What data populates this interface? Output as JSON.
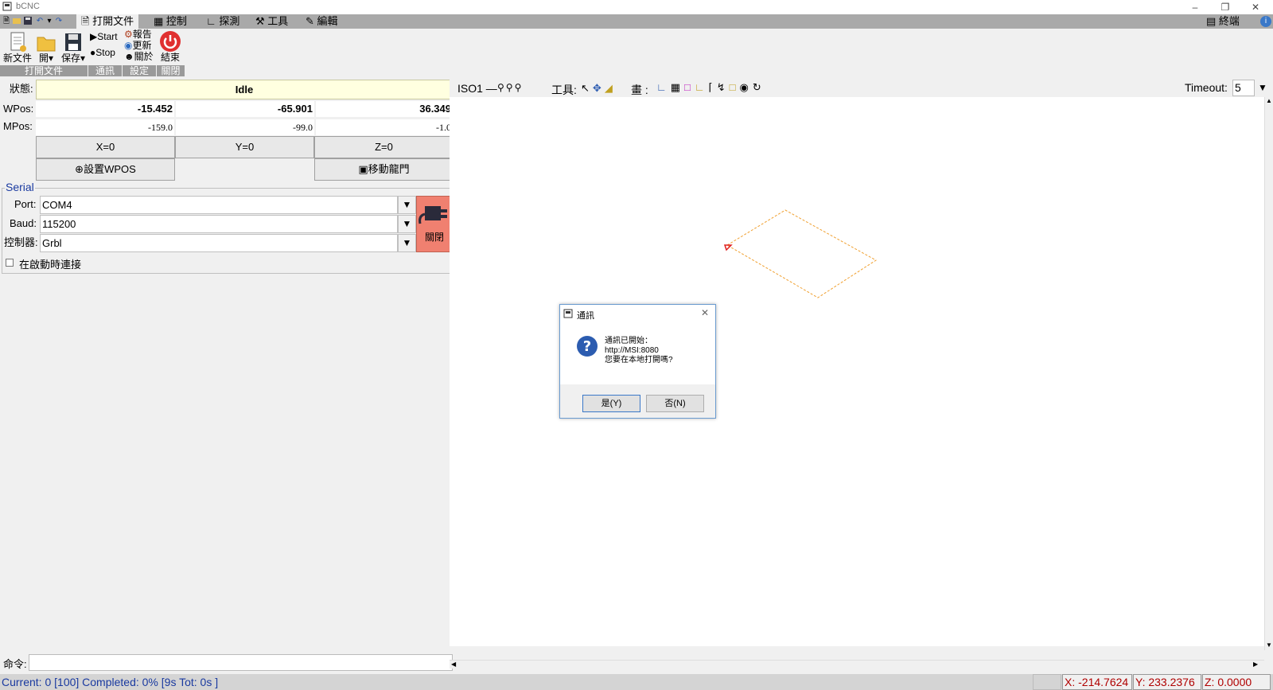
{
  "window": {
    "title": "bCNC"
  },
  "tabs": [
    {
      "label": "打開文件"
    },
    {
      "label": "控制"
    },
    {
      "label": "探測"
    },
    {
      "label": "工具"
    },
    {
      "label": "編輯"
    }
  ],
  "terminal_tab": "終端",
  "ribbon": {
    "new_file": "新文件",
    "open": "開",
    "save": "保存",
    "start": "Start",
    "stop": "Stop",
    "report": "報告",
    "update": "更新",
    "about": "關於",
    "exit": "結束",
    "groups": [
      "打開文件",
      "通訊",
      "設定",
      "關閉"
    ]
  },
  "dro": {
    "state_label": "狀態:",
    "state": "Idle",
    "wpos_label": "WPos:",
    "wpos": [
      "-15.452",
      "-65.901",
      "36.349"
    ],
    "mpos_label": "MPos:",
    "mpos": [
      "-159.0",
      "-99.0",
      "-1.0"
    ],
    "zero_x": "X=0",
    "zero_y": "Y=0",
    "zero_z": "Z=0",
    "set_wpos": "設置WPOS",
    "move_gantry": "移動龍門"
  },
  "serial": {
    "title": "Serial",
    "port_label": "Port:",
    "port": "COM4",
    "baud_label": "Baud:",
    "baud": "115200",
    "controller_label": "控制器:",
    "controller": "Grbl",
    "connect_on_start": "在啟動時連接",
    "close_button": "關閉"
  },
  "command": {
    "label": "命令:"
  },
  "canvas_toolbar": {
    "view": "ISO1",
    "tools_label": "工具:",
    "draw_label": "畫 :",
    "timeout_label": "Timeout:",
    "timeout": "5"
  },
  "dialog": {
    "title": "通訊",
    "line1": "通訊已開始：",
    "line2": "http://MSI:8080",
    "line3": "您要在本地打開嗎?",
    "yes": "是(Y)",
    "no": "否(N)"
  },
  "status": {
    "left": "Current: 0 [100]  Completed: 0% [9s Tot: 0s ]",
    "x": "X: -214.7624",
    "y": "Y: 233.2376",
    "z": "Z: 0.0000"
  },
  "colors": {
    "state_bg": "#ffffe0",
    "close_button_bg": "#f08070",
    "status_text": "#1a3aa0",
    "coord_text": "#b00000",
    "path": "#f0a030"
  }
}
